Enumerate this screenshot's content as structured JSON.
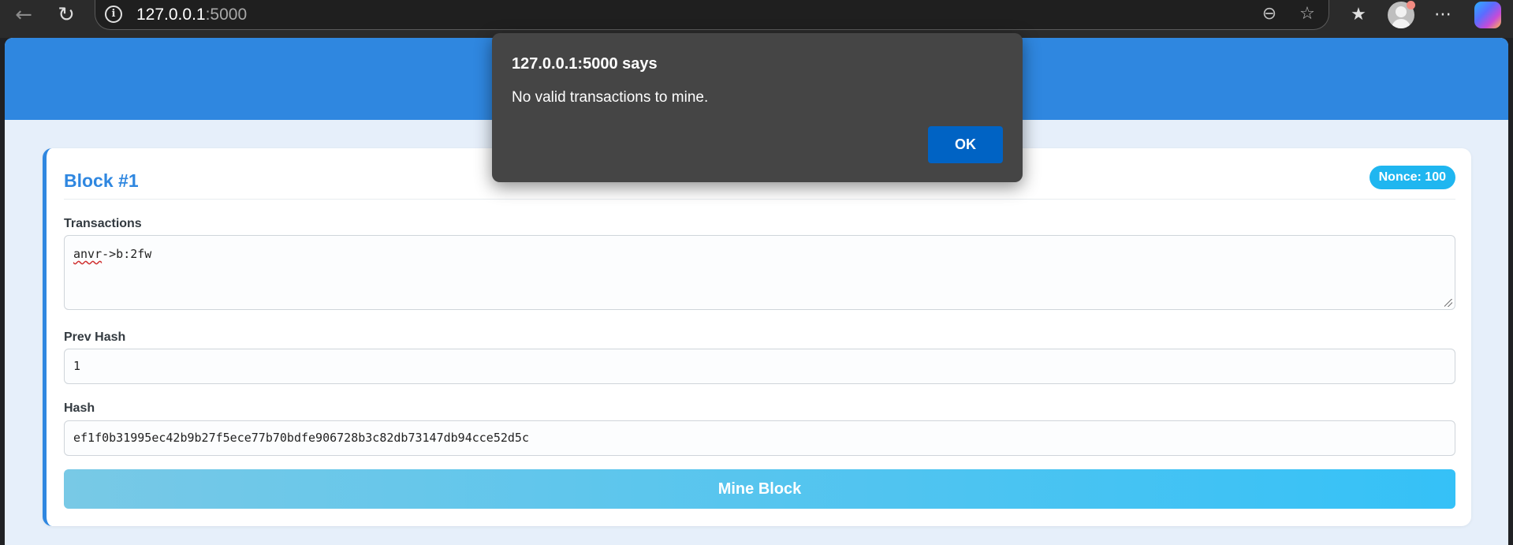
{
  "browser": {
    "url_host": "127.0.0.1",
    "url_port": ":5000",
    "icons": {
      "back": "back-arrow-icon",
      "reload": "reload-icon",
      "site_info": "info-icon",
      "zoom": "zoom-out-icon",
      "favorite": "star-icon",
      "favorites": "favorites-icon",
      "profile": "profile-avatar-icon",
      "more": "more-icon",
      "copilot": "copilot-icon"
    }
  },
  "block": {
    "title": "Block #1",
    "nonce_badge": "Nonce: 100",
    "transactions_label": "Transactions",
    "transactions_value_misspelled": "anvr",
    "transactions_value_rest": "->b:2fw",
    "prev_hash_label": "Prev Hash",
    "prev_hash_value": "1",
    "hash_label": "Hash",
    "hash_value": "ef1f0b31995ec42b9b27f5ece77b70bdfe906728b3c82db73147db94cce52d5c",
    "mine_button": "Mine Block"
  },
  "alert": {
    "title": "127.0.0.1:5000 says",
    "message": "No valid transactions to mine.",
    "ok_button": "OK"
  },
  "colors": {
    "accent": "#2f87e0",
    "badge": "#1fb6f0",
    "dialog_bg": "#454545",
    "dialog_button": "#0063c4"
  }
}
